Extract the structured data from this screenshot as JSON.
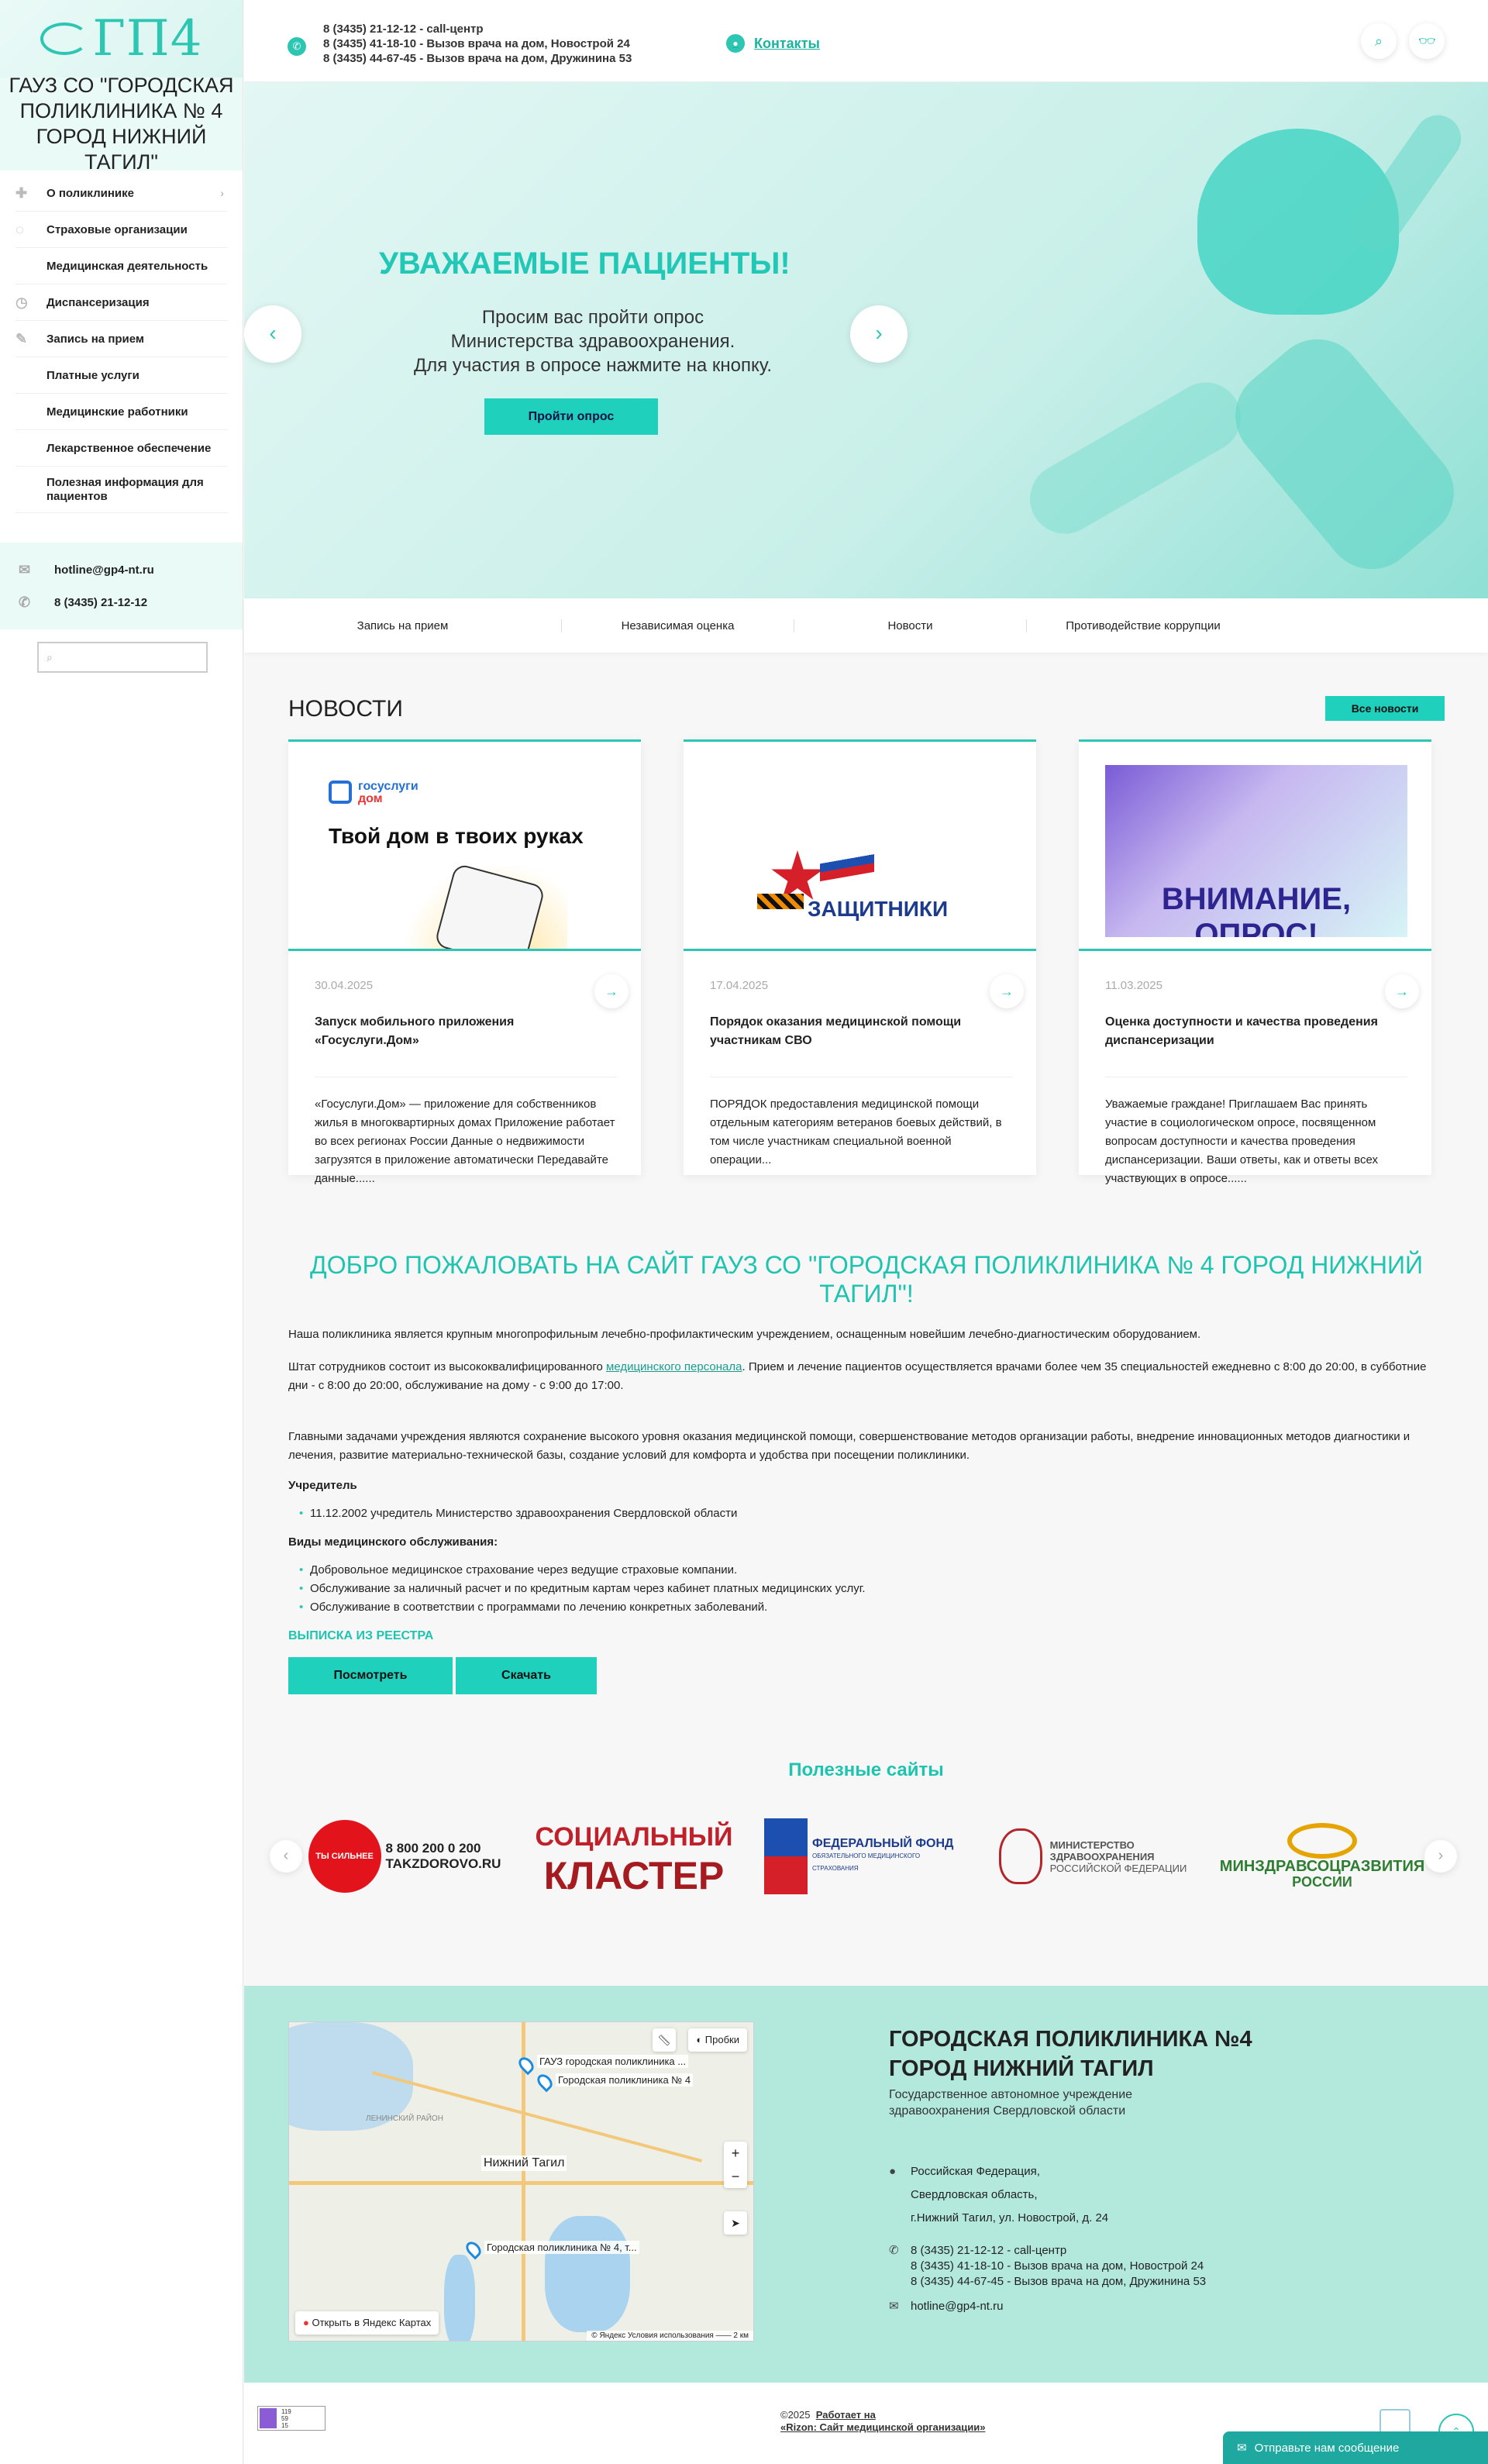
{
  "logo": {
    "text": "ГП4"
  },
  "org_name": "ГАУЗ СО \"ГОРОДСКАЯ ПОЛИКЛИНИКА № 4 ГОРОД НИЖНИЙ ТАГИЛ\"",
  "menu": [
    {
      "label": "О поликлинике",
      "icon": "plus-icon"
    },
    {
      "label": "Страховые организации",
      "icon": "shield-icon"
    },
    {
      "label": "Медицинская деятельность",
      "icon": ""
    },
    {
      "label": "Диспансеризация",
      "icon": "clock-icon"
    },
    {
      "label": "Запись на прием",
      "icon": "edit-icon"
    },
    {
      "label": "Платные услуги",
      "icon": ""
    },
    {
      "label": "Медицинские работники",
      "icon": ""
    },
    {
      "label": "Лекарственное обеспечение",
      "icon": ""
    },
    {
      "label": "Полезная информация для пациентов",
      "icon": ""
    }
  ],
  "sidebar_contacts": {
    "email": "hotline@gp4-nt.ru",
    "phone": "8 (3435) 21-12-12"
  },
  "header": {
    "phones": [
      "8 (3435) 21-12-12 - call-центр",
      "8 (3435) 41-18-10 - Вызов врача на дом, Новострой 24",
      "8 (3435) 44-67-45 - Вызов врача на дом, Дружинина 53"
    ],
    "contacts_link": "Контакты"
  },
  "slider": {
    "heading": "УВАЖАЕМЫЕ ПАЦИЕНТЫ!",
    "text": [
      "Просим вас пройти опрос",
      "Министерства здравоохранения.",
      "Для участия в опросе нажмите на кнопку."
    ],
    "button": "Пройти опрос"
  },
  "subnav": [
    "Запись на прием",
    "Независимая оценка",
    "Новости",
    "Противодействие коррупции"
  ],
  "news": {
    "heading": "НОВОСТИ",
    "all_label": "Все новости",
    "items": [
      {
        "date": "30.04.2025",
        "title": "Запуск мобильного приложения «Госуслуги.Дом»",
        "desc": "«Госуслуги.Дом» — приложение для собственников жилья в многоквартирных домах Приложение работает во всех регионах России Данные о недвижимости загрузятся в приложение автоматически Передавайте данные......",
        "img_logo": "госуслуги",
        "img_logo2": "дом",
        "img_title": "Твой дом в твоих руках"
      },
      {
        "date": "17.04.2025",
        "title": "Порядок оказания медицинской помощи участникам СВО",
        "desc": "ПОРЯДОК предоставления медицинской помощи отдельным категориям ветеранов боевых действий, в том числе участникам специальной военной операции...",
        "img_title": "ЗАЩИТНИКИ"
      },
      {
        "date": "11.03.2025",
        "title": "Оценка доступности и качества проведения диспансеризации",
        "desc": "Уважаемые граждане! Приглашаем Вас принять участие в социологическом опросе, посвященном вопросам доступности и качества проведения диспансеризации. Ваши ответы, как и ответы всех участвующих в опросе......",
        "img_title": "ВНИМАНИЕ, ОПРОС!"
      }
    ]
  },
  "welcome": {
    "heading": "ДОБРО ПОЖАЛОВАТЬ НА САЙТ ГАУЗ СО \"ГОРОДСКАЯ ПОЛИКЛИНИКА № 4 ГОРОД НИЖНИЙ ТАГИЛ\"!",
    "p1": "Наша поликлиника является крупным многопрофильным лечебно-профилактическим учреждением, оснащенным новейшим лечебно-диагностическим оборудованием.",
    "p2_a": "Штат сотрудников состоит из высококвалифицированного ",
    "p2_link": "медицинского персонала",
    "p2_b": ". Прием и лечение пациентов осуществляется врачами более чем 35 специальностей ежедневно с 8:00 до 20:00, в субботние дни - с 8:00 до 20:00, обслуживание на дому - с 9:00 до 17:00.",
    "p3": "Главными задачами учреждения являются сохранение высокого уровня оказания медицинской помощи, совершенствование методов организации работы, внедрение инновационных методов диагностики и лечения, развитие материально-технической базы, создание условий для комфорта и удобства при посещении поликлиники.",
    "founder_label": "Учредитель",
    "founder": "11.12.2002 учредитель Министерство здравоохранения Свердловской области",
    "service_label": "Виды медицинского обслуживания:",
    "services": [
      "Добровольное медицинское страхование через ведущие страховые компании.",
      "Обслуживание за наличный расчет и по кредитным картам через кабинет платных медицинских услуг.",
      "Обслуживание в соответствии с программами по лечению конкретных заболеваний."
    ],
    "extract_label": "ВЫПИСКА ИЗ РЕЕСТРА",
    "btn_view": "Посмотреть",
    "btn_download": "Скачать"
  },
  "useful": {
    "heading": "Полезные сайты",
    "partners": [
      {
        "line1": "ТЫ СИЛЬНЕЕ",
        "line2": "8 800 200 0 200",
        "line3": "TAKZDOROVO.RU"
      },
      {
        "line1": "СОЦИАЛЬНЫЙ",
        "line2": "КЛАСТЕР"
      },
      {
        "line1": "ФЕДЕРАЛЬНЫЙ ФОНД",
        "line2": "ОБЯЗАТЕЛЬНОГО МЕДИЦИНСКОГО СТРАХОВАНИЯ"
      },
      {
        "line1": "МИНИСТЕРСТВО",
        "line2": "ЗДРАВООХРАНЕНИЯ",
        "line3": "РОССИЙСКОЙ ФЕДЕРАЦИИ"
      },
      {
        "line1": "МИНЗДРАВСОЦРАЗВИТИЯ",
        "line2": "РОССИИ"
      }
    ]
  },
  "map": {
    "traffic": "Пробки",
    "open": "Открыть в Яндекс Картах",
    "city": "Нижний Тагил",
    "district": "ЛЕНИНСКИЙ РАЙОН",
    "labels": [
      "ГАУЗ городская поликлиника ...",
      "Городская поликлиника № 4",
      "Городская поликлиника № 4, т..."
    ],
    "copyright": "© Яндекс  Условия использования  —— 2 км"
  },
  "footer": {
    "heading1": "ГОРОДСКАЯ ПОЛИКЛИНИКА №4",
    "heading2": "ГОРОД НИЖНИЙ ТАГИЛ",
    "sub": "Государственное автономное учреждение здравоохранения Свердловской области",
    "address": [
      "Российская Федерация,",
      "Свердловская область,",
      "г.Нижний Тагил, ул. Новострой, д. 24"
    ],
    "phones": [
      "8 (3435) 21-12-12 - call-центр",
      "8 (3435) 41-18-10 - Вызов врача на дом, Новострой 24",
      "8 (3435) 44-67-45 - Вызов врача на дом, Дружинина 53"
    ],
    "email": "hotline@gp4-nt.ru"
  },
  "bottom": {
    "counter": [
      "119",
      "59",
      "15"
    ],
    "copyright": "©2025",
    "made_by": "Работает на",
    "made_link": "«Rizon: Сайт медицинской организации»",
    "feedback": "Отправьте нам сообщение"
  },
  "colors": {
    "accent": "#2dc6b3",
    "button": "#1fd0bd",
    "footer_bg": "#b3e9dd"
  }
}
